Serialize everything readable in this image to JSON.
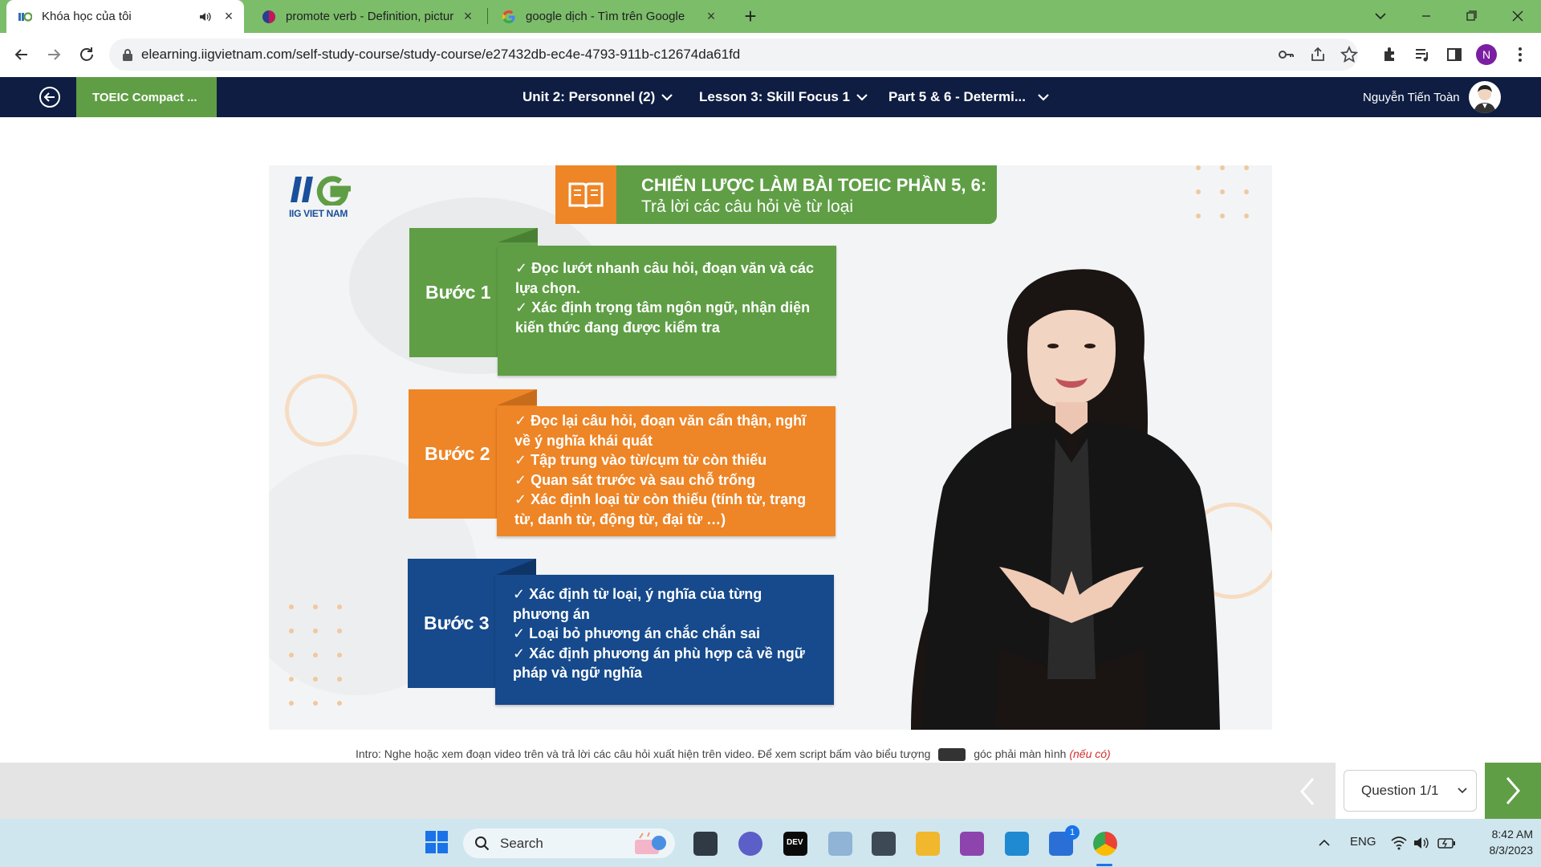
{
  "browser": {
    "tabs": [
      {
        "title": "Khóa học của tôi",
        "active": true
      },
      {
        "title": "promote verb - Definition, pictur",
        "active": false
      },
      {
        "title": "google dịch - Tìm trên Google",
        "active": false
      }
    ],
    "new_tab_label": "+",
    "url": "elearning.iigvietnam.com/self-study-course/study-course/e27432db-ec4e-4793-911b-c12674da61fd",
    "profile_initial": "N"
  },
  "nav": {
    "course": "TOEIC Compact ...",
    "unit": "Unit 2: Personnel (2)",
    "lesson": "Lesson 3: Skill Focus 1",
    "part": "Part 5 & 6 - Determi...",
    "user_name": "Nguyễn Tiến Toàn"
  },
  "slide": {
    "logo_text": "IIG VIET NAM",
    "logo_mark": "IIG",
    "title_line1": "CHIẾN LƯỢC LÀM BÀI TOEIC PHẦN 5, 6:",
    "title_line2": "Trả lời các câu hỏi về từ loại",
    "steps": [
      {
        "label": "Bước 1",
        "lines": [
          "✓ Đọc lướt nhanh câu hỏi, đoạn văn và các",
          "lựa chọn.",
          "✓ Xác định trọng tâm ngôn ngữ, nhận diện",
          "kiến thức đang được kiểm tra"
        ]
      },
      {
        "label": "Bước 2",
        "lines": [
          "✓ Đọc lại câu hỏi, đoạn văn cẩn thận, nghĩ",
          "về ý nghĩa khái quát",
          "✓ Tập trung vào từ/cụm từ còn thiếu",
          "✓ Quan sát trước và sau chỗ trống",
          "✓ Xác định loại từ còn thiếu (tính từ, trạng",
          "từ, danh từ, động từ, đại từ …)"
        ]
      },
      {
        "label": "Bước 3",
        "lines": [
          "✓ Xác định từ loại, ý nghĩa của từng",
          "phương án",
          "✓ Loại bỏ phương án chắc chắn sai",
          "✓ Xác định phương án phù hợp cả về ngữ",
          "pháp và ngữ nghĩa"
        ]
      }
    ],
    "colors": {
      "step1": "#5f9e45",
      "step2": "#ee8526",
      "step3": "#164a8c",
      "title_bg": "#5f9e45",
      "icon_bg": "#ee8526"
    }
  },
  "intro_text": "Intro: Nghe hoặc xem đoạn video trên và trả lời các câu hỏi xuất hiện trên video. Để xem script bấm vào biểu tượng",
  "intro_text_tail": "góc phải màn hình",
  "intro_link": "(nếu có)",
  "question_select": {
    "value": "Question 1/1"
  },
  "taskbar": {
    "search_placeholder": "Search",
    "language": "ENG",
    "time": "8:42 AM",
    "date": "8/3/2023",
    "todo_badge": "1"
  },
  "icons": [
    "back-arrow-icon",
    "forward-arrow-icon",
    "reload-icon",
    "lock-icon",
    "key-icon",
    "share-icon",
    "star-icon",
    "extensions-icon",
    "media-icon",
    "sidebar-icon",
    "menu-icon",
    "speaker-icon",
    "chevron-down-icon",
    "exit-icon",
    "book-icon",
    "chevron-left-icon",
    "chevron-right-icon",
    "windows-icon",
    "search-icon",
    "wifi-icon",
    "volume-icon",
    "battery-icon"
  ]
}
